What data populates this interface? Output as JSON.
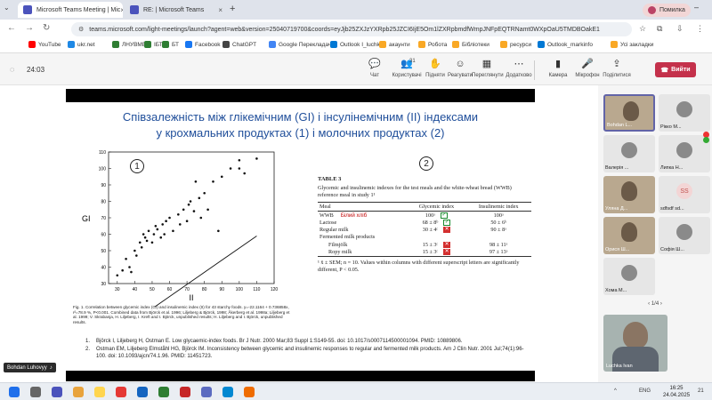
{
  "browser": {
    "tabs": [
      {
        "title": "Microsoft Teams Meeting | Mic",
        "color": "#4b53bc"
      },
      {
        "title": "RE: | Microsoft Teams",
        "color": "#4b53bc"
      }
    ],
    "profile_label": "Помилка",
    "url": "teams.microsoft.com/light-meetings/launch?agent=web&version=25040719700&coords=eyJjb25ZXJzYXRpb25JZCI6IjE5Om1lZXRpbmdfWmpJNFpEQTRNamt0WXpOaU5TMDBOakE1"
  },
  "bookmarks": [
    {
      "label": "YouTube",
      "color": "#ff0000"
    },
    {
      "label": "ukr.net",
      "color": "#1e88e5"
    },
    {
      "label": "ЛНУВМБТ",
      "color": "#2e7d32"
    },
    {
      "label": "ІБТ",
      "color": "#2e7d32"
    },
    {
      "label": "БТ",
      "color": "#2e7d32"
    },
    {
      "label": "Facebook",
      "color": "#1877f2"
    },
    {
      "label": "ChatGPT",
      "color": "#444444"
    },
    {
      "label": "Google Перекладач",
      "color": "#4285f4"
    },
    {
      "label": "Outlook I_luchka",
      "color": "#0078d4"
    },
    {
      "label": "акаунти",
      "color": "#f9a825"
    },
    {
      "label": "Робота",
      "color": "#f9a825"
    },
    {
      "label": "Бібліотеки",
      "color": "#f9a825"
    },
    {
      "label": "ресурси",
      "color": "#f9a825"
    },
    {
      "label": "Outlook_markinfo",
      "color": "#0078d4"
    },
    {
      "label": "Усі закладки",
      "color": "#f9a825"
    }
  ],
  "meeting": {
    "timer": "24:03",
    "controls": [
      {
        "label": "Чат",
        "glyph": "💬",
        "badge": ""
      },
      {
        "label": "Користувачі",
        "glyph": "👥",
        "badge": "31"
      },
      {
        "label": "Підняти",
        "glyph": "✋",
        "badge": ""
      },
      {
        "label": "Реагувати",
        "glyph": "☺",
        "badge": ""
      },
      {
        "label": "Переглянути",
        "glyph": "▦",
        "badge": ""
      },
      {
        "label": "Додатково",
        "glyph": "⋯",
        "badge": ""
      },
      {
        "label": "Камера",
        "glyph": "▮",
        "badge": ""
      },
      {
        "label": "Мікрофон",
        "glyph": "🎤",
        "badge": ""
      },
      {
        "label": "Поділитися",
        "glyph": "⇪",
        "badge": ""
      }
    ],
    "leave_label": "Вийти",
    "presenter": "Bohdan Luhovyy"
  },
  "slide": {
    "title_line1": "Співзалежність між глікемічним (GI) і інсулінемічним (ІІ) індексами",
    "title_line2": "у крохмальних продуктах (1) і молочних продуктах (2)",
    "circle1": "1",
    "circle2": "2",
    "fig_caption": "Fig. 1. Correlation between glycemic index (GI) and insulinemic index (II) for 43 starchy foods. y=-22.1164 + 0.736858x, r²=78.9 %, P<0.001. Combined data from Björck et al. 1996; Liljeberg & Björck, 1998; Åkerberg et al. 1998a; Liljeberg et al. 1999; V. Skrabanja, H. Liljeberg, I. Kreft and I. Björck, unpublished results; H. Liljeberg and I. Björck, unpublished results.",
    "table": {
      "title": "TABLE 3",
      "desc": "Glycemic and insulinemic indexes for the test meals and the white-wheat bread (WWB) reference meal in study 1¹",
      "headers": [
        "Meal",
        "Glycemic index",
        "Insulinemic index"
      ],
      "wwb_note": "Білий хліб",
      "rows": [
        {
          "meal": "WWB",
          "gi": "100ᵃ",
          "ii": "100ᵃ",
          "mark": "check",
          "indent": false,
          "note": true
        },
        {
          "meal": "Lactose",
          "gi": "68 ± 8ᵇ",
          "ii": "50 ± 6ᵇ",
          "mark": "check",
          "indent": false,
          "note": false
        },
        {
          "meal": "Regular milk",
          "gi": "30 ± 4ᶜ",
          "ii": "90 ± 8ᵃ",
          "mark": "cross",
          "indent": false,
          "note": false
        },
        {
          "meal": "Fermented milk products",
          "gi": "",
          "ii": "",
          "mark": "",
          "indent": false,
          "note": false
        },
        {
          "meal": "Filmjölk",
          "gi": "15 ± 3ᶜ",
          "ii": "98 ± 11ᵃ",
          "mark": "cross",
          "indent": true,
          "note": false
        },
        {
          "meal": "Ropy milk",
          "gi": "15 ± 3ᶜ",
          "ii": "97 ± 13ᵃ",
          "mark": "cross",
          "indent": true,
          "note": false
        }
      ],
      "footnote": "¹ x̄ ± SEM; n = 10. Values within columns with different superscript letters are significantly different, P < 0.05."
    },
    "references": [
      {
        "n": "1.",
        "text": "Björck I, Liljeberg H, Ostman E. Low glycaemic-index foods. Br J Nutr. 2000 Mar;83 Suppl 1:S149-55. doi: 10.1017/s0007114500001094. PMID: 10889806."
      },
      {
        "n": "2.",
        "text": "Ostman EM, Liljeberg Elmståhl HG, Björck IM. Inconsistency between glycemic and insulinemic responses to regular and fermented milk products. Am J Clin Nutr. 2001 Jul;74(1):96-100. doi: 10.1093/ajcn/74.1.96. PMID: 11451723."
      }
    ]
  },
  "chart_data": {
    "type": "scatter",
    "xlabel": "II",
    "ylabel": "GI",
    "xlim": [
      25,
      120
    ],
    "ylim": [
      30,
      110
    ],
    "xticks": [
      "30",
      "40",
      "50",
      "60",
      "70",
      "80",
      "90",
      "100",
      "110",
      "120"
    ],
    "yticks": [
      "30",
      "40",
      "50",
      "60",
      "70",
      "80",
      "90",
      "100",
      "110"
    ],
    "x": [
      30,
      33,
      35,
      37,
      38,
      40,
      41,
      43,
      44,
      45,
      46,
      47,
      48,
      50,
      51,
      52,
      53,
      55,
      56,
      57,
      58,
      60,
      62,
      65,
      66,
      68,
      70,
      71,
      72,
      74,
      75,
      77,
      78,
      80,
      82,
      85,
      88,
      90,
      95,
      100,
      100,
      103,
      110
    ],
    "y": [
      35,
      38,
      45,
      40,
      37,
      50,
      47,
      55,
      52,
      60,
      58,
      56,
      62,
      55,
      60,
      65,
      63,
      58,
      66,
      60,
      68,
      70,
      62,
      72,
      66,
      75,
      68,
      78,
      80,
      74,
      92,
      82,
      70,
      85,
      75,
      92,
      62,
      95,
      100,
      100,
      105,
      97,
      106
    ],
    "regression": {
      "intercept": -22.1164,
      "slope": 0.736858
    }
  },
  "participants": [
    {
      "name": "Bohdan L...",
      "video": true,
      "active": true
    },
    {
      "name": "Рікко М...",
      "video": false,
      "active": false
    },
    {
      "name": "Валерія ...",
      "video": false,
      "active": false
    },
    {
      "name": "Липка Н...",
      "video": false,
      "active": false
    },
    {
      "name": "Уляна Д...",
      "video": true,
      "active": false
    },
    {
      "name": "sdfsdf sd...",
      "video": false,
      "active": false,
      "initials": "SS"
    },
    {
      "name": "Орися Ш...",
      "video": true,
      "active": false
    },
    {
      "name": "Софія Ш...",
      "video": false,
      "active": false
    },
    {
      "name": "Хома М...",
      "video": false,
      "active": false
    }
  ],
  "pager": "1/4",
  "big_tile_name": "Luchka Ivan",
  "taskbar": {
    "lang": "ENG",
    "time": "16:25",
    "date": "24.04.2025",
    "notif": "21"
  }
}
